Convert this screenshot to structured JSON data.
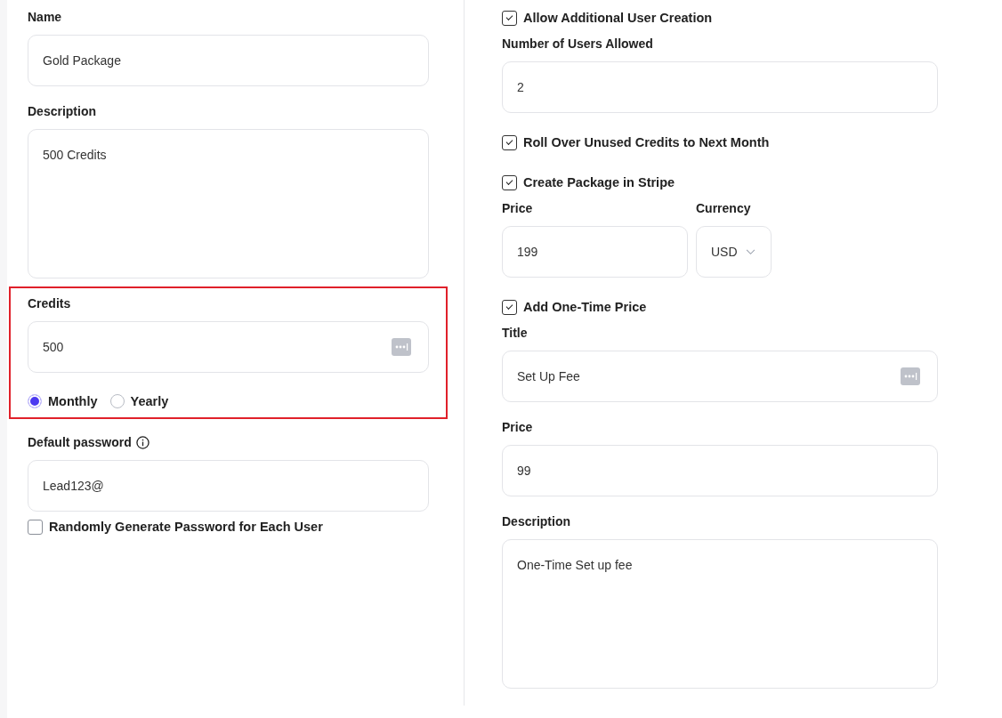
{
  "left": {
    "name": {
      "label": "Name",
      "value": "Gold Package"
    },
    "description": {
      "label": "Description",
      "value": "500 Credits"
    },
    "credits": {
      "label": "Credits",
      "value": "500",
      "highlighted": true,
      "periods": [
        {
          "label": "Monthly",
          "selected": true
        },
        {
          "label": "Yearly",
          "selected": false
        }
      ]
    },
    "default_password": {
      "label": "Default password",
      "value": "Lead123@"
    },
    "random_password": {
      "label": "Randomly Generate Password for Each User",
      "checked": false
    }
  },
  "right": {
    "allow_additional_users": {
      "label": "Allow Additional User Creation",
      "checked": true
    },
    "users_allowed": {
      "label": "Number of Users Allowed",
      "value": "2"
    },
    "roll_over": {
      "label": "Roll Over Unused Credits to Next Month",
      "checked": true
    },
    "stripe_package": {
      "label": "Create Package in Stripe",
      "checked": true
    },
    "price": {
      "label": "Price",
      "value": "199"
    },
    "currency": {
      "label": "Currency",
      "value": "USD"
    },
    "one_time_price": {
      "label": "Add One-Time Price",
      "checked": true
    },
    "title": {
      "label": "Title",
      "value": "Set Up Fee"
    },
    "one_time_amount": {
      "label": "Price",
      "value": "99"
    },
    "one_time_description": {
      "label": "Description",
      "value": "One-Time Set up fee"
    }
  }
}
